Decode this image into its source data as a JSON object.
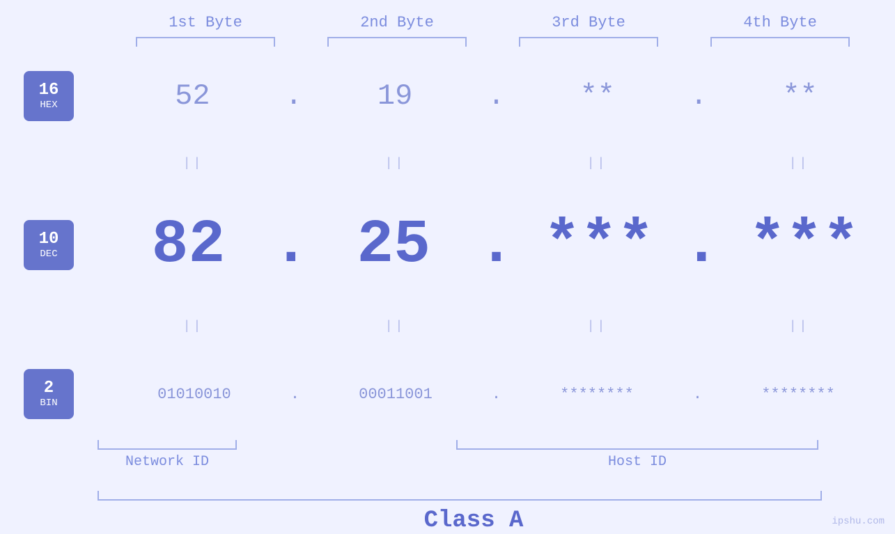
{
  "headers": {
    "byte1": "1st Byte",
    "byte2": "2nd Byte",
    "byte3": "3rd Byte",
    "byte4": "4th Byte"
  },
  "bases": [
    {
      "number": "16",
      "label": "HEX"
    },
    {
      "number": "10",
      "label": "DEC"
    },
    {
      "number": "2",
      "label": "BIN"
    }
  ],
  "values": {
    "hex": {
      "b1": "52",
      "b2": "19",
      "b3": "**",
      "b4": "**"
    },
    "dec": {
      "b1": "82",
      "b2": "25",
      "b3": "***",
      "b4": "***"
    },
    "bin": {
      "b1": "01010010",
      "b2": "00011001",
      "b3": "********",
      "b4": "********"
    }
  },
  "dots": {
    "char": "."
  },
  "separators": {
    "char": "||"
  },
  "labels": {
    "network_id": "Network ID",
    "host_id": "Host ID",
    "class": "Class A"
  },
  "watermark": "ipshu.com",
  "colors": {
    "badge_bg": "#6674cc",
    "value_light": "#8a96d9",
    "value_dark": "#5a68cc",
    "bracket": "#a0aee8",
    "sep": "#b0b8e8"
  }
}
